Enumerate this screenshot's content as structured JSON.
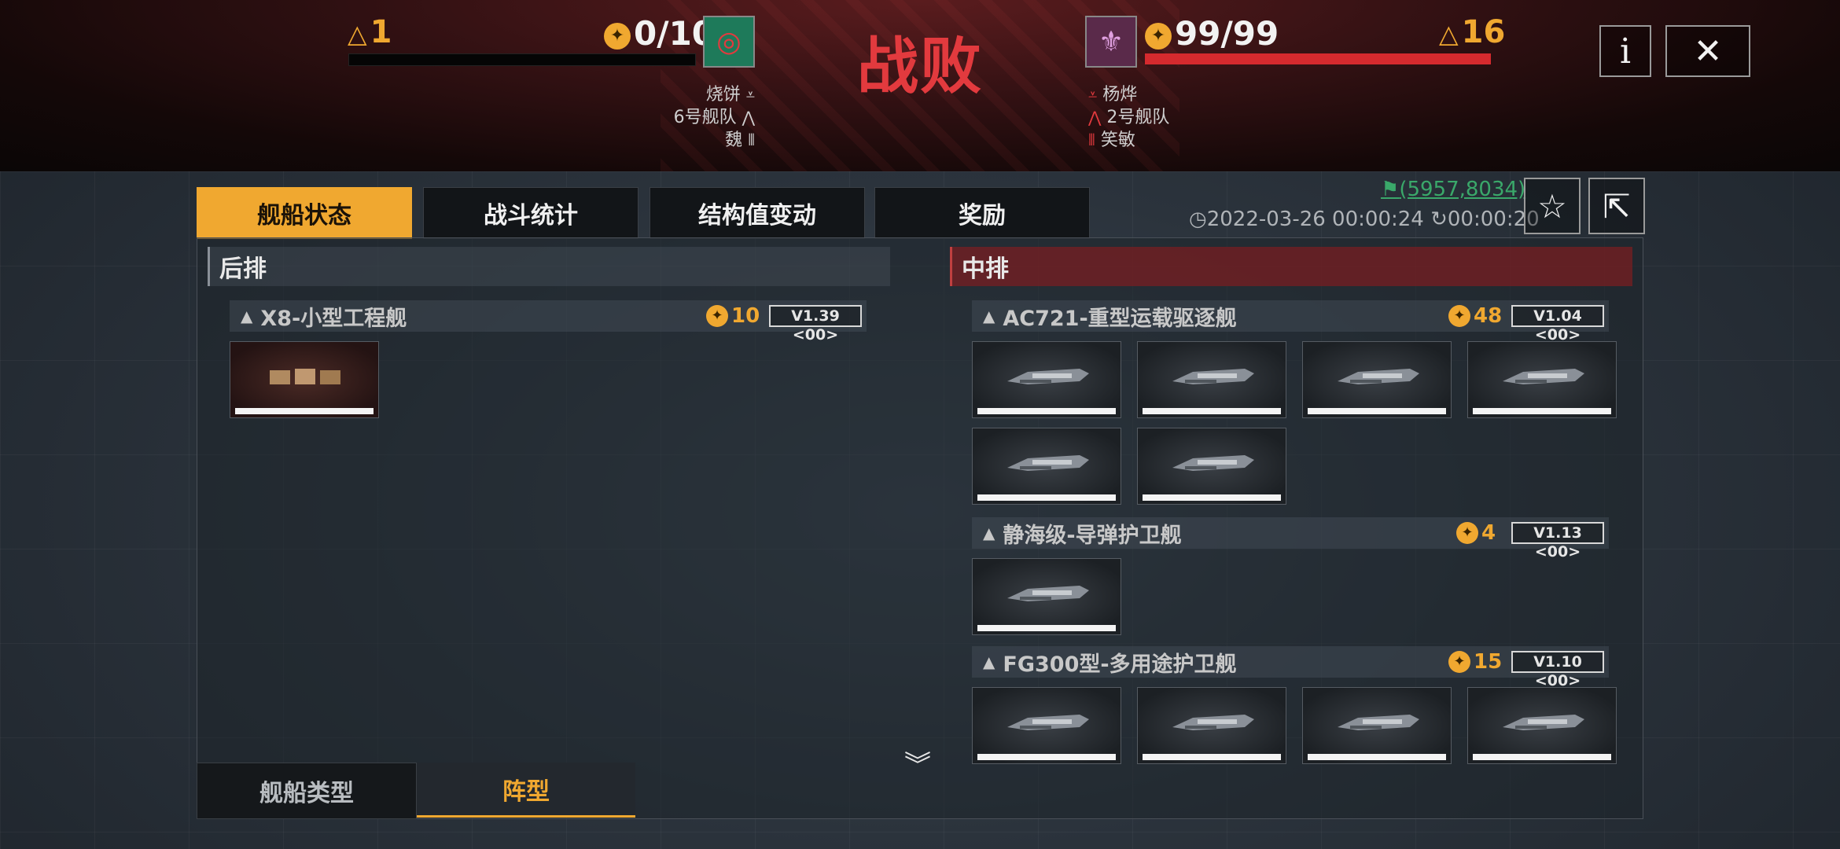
{
  "header": {
    "result": "战败",
    "left": {
      "level": "1",
      "score": "0/10",
      "player": "烧饼",
      "fleet": "6号舰队",
      "alliance": "魏",
      "emblem_color": "#1e7a5a"
    },
    "right": {
      "level": "16",
      "score": "99/99",
      "player": "杨烨",
      "fleet": "2号舰队",
      "alliance": "笑敏",
      "emblem_color": "#5a2a4a"
    },
    "info_label": "i",
    "close_label": "✕"
  },
  "tabs": [
    {
      "label": "舰船状态",
      "active": true
    },
    {
      "label": "战斗统计",
      "active": false
    },
    {
      "label": "结构值变动",
      "active": false
    },
    {
      "label": "奖励",
      "active": false
    }
  ],
  "meta": {
    "coords": "(5957,8034)",
    "datetime": "2022-03-26 00:00:24",
    "duration": "00:00:20"
  },
  "columns": {
    "back": {
      "title": "后排",
      "ships": [
        {
          "name": "X8-小型工程舰",
          "cost": "10",
          "version": "V1.39 <00>",
          "count": 1
        }
      ]
    },
    "middle": {
      "title": "中排",
      "ships": [
        {
          "name": "AC721-重型运载驱逐舰",
          "cost": "48",
          "version": "V1.04 <00>",
          "count": 6
        },
        {
          "name": "静海级-导弹护卫舰",
          "cost": "4",
          "version": "V1.13 <00>",
          "count": 1
        },
        {
          "name": "FG300型-多用途护卫舰",
          "cost": "15",
          "version": "V1.10 <00>",
          "count": 4
        }
      ]
    }
  },
  "bottom_tabs": [
    {
      "label": "舰船类型",
      "active": false
    },
    {
      "label": "阵型",
      "active": true
    }
  ],
  "colors": {
    "accent": "#f0a830",
    "defeat_red": "#e23a3e",
    "enemy_bar": "#d52a2e",
    "coords_green": "#3aa86a"
  }
}
